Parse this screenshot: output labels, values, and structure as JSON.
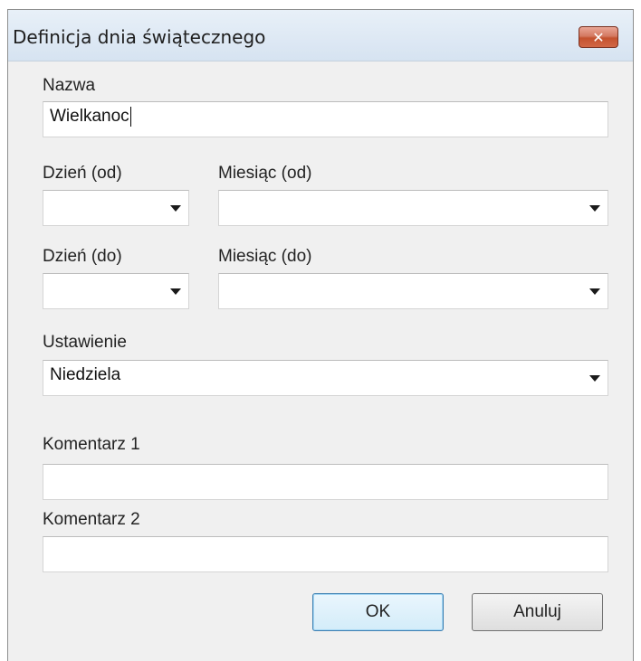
{
  "window": {
    "title": "Definicja dnia świątecznego",
    "close_glyph": "✕"
  },
  "form": {
    "name": {
      "label": "Nazwa",
      "value": "Wielkanoc"
    },
    "day_from": {
      "label": "Dzień (od)",
      "value": ""
    },
    "month_from": {
      "label": "Miesiąc (od)",
      "value": ""
    },
    "day_to": {
      "label": "Dzień (do)",
      "value": ""
    },
    "month_to": {
      "label": "Miesiąc (do)",
      "value": ""
    },
    "setting": {
      "label": "Ustawienie",
      "value": "Niedziela"
    },
    "comment1": {
      "label": "Komentarz 1",
      "value": ""
    },
    "comment2": {
      "label": "Komentarz 2",
      "value": ""
    }
  },
  "buttons": {
    "ok_label": "OK",
    "cancel_label": "Anuluj"
  },
  "colors": {
    "dialog_bg": "#f0f0f0",
    "title_bg": "#dae6f3",
    "close_red": "#c4522f",
    "default_button_border": "#3c7fb1"
  },
  "icons": {
    "close": "close-icon",
    "dropdown": "chevron-down-icon"
  }
}
